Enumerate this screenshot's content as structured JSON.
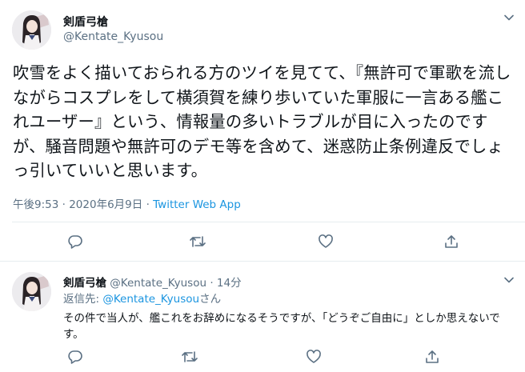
{
  "main_tweet": {
    "display_name": "剣盾弓槍",
    "handle": "@Kentate_Kyusou",
    "text": "吹雪をよく描いておられる方のツイを見てて、『無許可で軍歌を流しながらコスプレをして横須賀を練り歩いていた軍服に一言ある艦これユーザー』という、情報量の多いトラブルが目に入ったのですが、騒音問題や無許可のデモ等を含めて、迷惑防止条例違反でしょっ引いていいと思います。",
    "time": "午後9:53",
    "separator": "·",
    "date": "2020年6月9日",
    "source": "Twitter Web App"
  },
  "reply_tweet": {
    "display_name": "剣盾弓槍",
    "handle": "@Kentate_Kyusou",
    "separator": "·",
    "age": "14分",
    "reply_to_label": "返信先: ",
    "reply_to_mention": "@Kentate_Kyusou",
    "reply_to_suffix": "さん",
    "text": "その件で当人が、艦これをお辞めになるそうですが、「どうぞご自由に」としか思えないです。"
  },
  "icons": [
    "chevron-down-icon",
    "reply-icon",
    "retweet-icon",
    "like-icon",
    "share-icon"
  ],
  "colors": {
    "link": "#1b95e0",
    "muted": "#5b7083",
    "text": "#0f1419",
    "divider": "#e6ecf0"
  }
}
